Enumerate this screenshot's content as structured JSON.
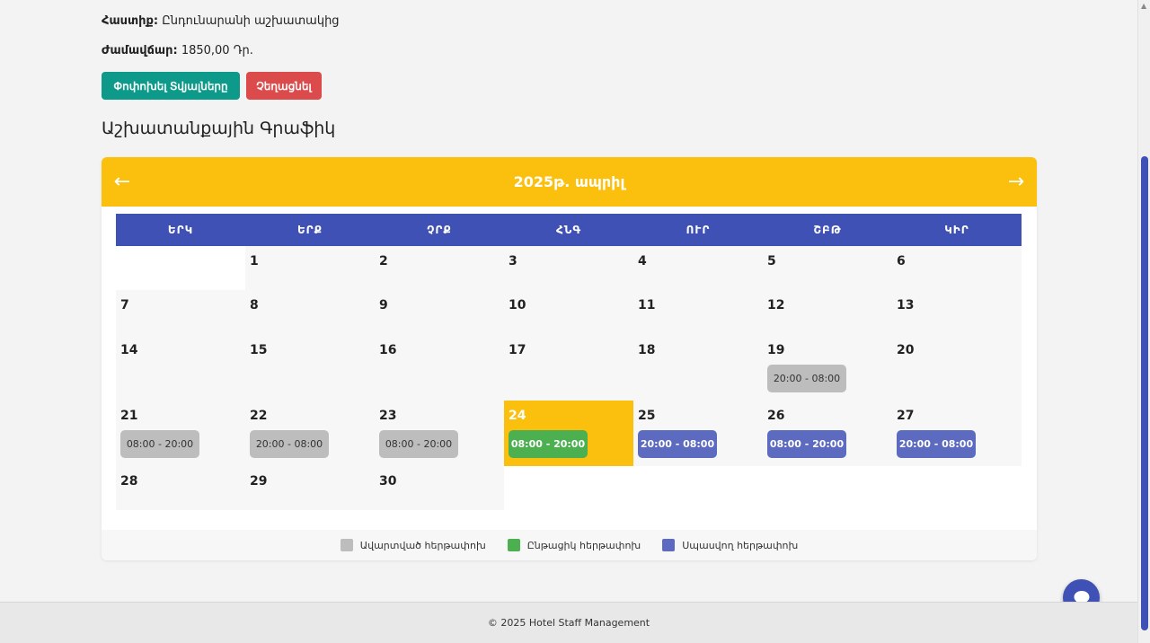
{
  "profile": {
    "position_label": "Հաստիք:",
    "position_value": "Ընդունարանի աշխատակից",
    "rate_label": "Ժամավճար:",
    "rate_value": "1850,00 Դր."
  },
  "actions": {
    "edit_label": "Փոփոխել Տվյալները",
    "cancel_label": "Չեղացնել"
  },
  "section_title": "Աշխատանքային Գրաֆիկ",
  "calendar": {
    "prev_arrow": "←",
    "next_arrow": "→",
    "month_title": "2025թ. ապրիլ",
    "weekdays": [
      "ԵՐԿ",
      "ԵՐՔ",
      "ՉՐՔ",
      "ՀՆԳ",
      "ՈՒՐ",
      "ՇԲԹ",
      "ԿԻՐ"
    ],
    "weeks": [
      [
        null,
        {
          "day": "1"
        },
        {
          "day": "2"
        },
        {
          "day": "3"
        },
        {
          "day": "4"
        },
        {
          "day": "5"
        },
        {
          "day": "6"
        }
      ],
      [
        {
          "day": "7"
        },
        {
          "day": "8"
        },
        {
          "day": "9"
        },
        {
          "day": "10"
        },
        {
          "day": "11"
        },
        {
          "day": "12"
        },
        {
          "day": "13"
        }
      ],
      [
        {
          "day": "14"
        },
        {
          "day": "15"
        },
        {
          "day": "16"
        },
        {
          "day": "17"
        },
        {
          "day": "18"
        },
        {
          "day": "19",
          "shift": "20:00 - 08:00",
          "status": "done"
        },
        {
          "day": "20"
        }
      ],
      [
        {
          "day": "21",
          "shift": "08:00 - 20:00",
          "status": "done"
        },
        {
          "day": "22",
          "shift": "20:00 - 08:00",
          "status": "done"
        },
        {
          "day": "23",
          "shift": "08:00 - 20:00",
          "status": "done"
        },
        {
          "day": "24",
          "shift": "08:00 - 20:00",
          "status": "cur",
          "today": true
        },
        {
          "day": "25",
          "shift": "20:00 - 08:00",
          "status": "up"
        },
        {
          "day": "26",
          "shift": "08:00 - 20:00",
          "status": "up"
        },
        {
          "day": "27",
          "shift": "20:00 - 08:00",
          "status": "up"
        }
      ],
      [
        {
          "day": "28"
        },
        {
          "day": "29"
        },
        {
          "day": "30"
        }
      ]
    ],
    "legend": [
      {
        "label": "Ավարտված հերթափոխ",
        "color": "#bdbdbd"
      },
      {
        "label": "Ընթացիկ հերթափոխ",
        "color": "#4caf50"
      },
      {
        "label": "Սպասվող հերթափոխ",
        "color": "#5c6bc0"
      }
    ]
  },
  "footer": {
    "text": "© 2025 Hotel Staff Management"
  },
  "chat": {
    "icon": "chat-bubble-icon"
  }
}
